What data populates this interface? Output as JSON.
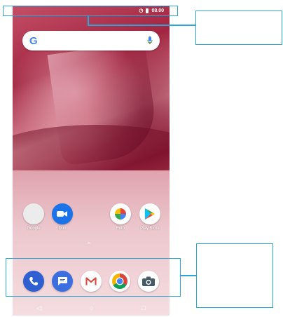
{
  "status_bar": {
    "time": "08.00"
  },
  "search": {
    "logo": "G"
  },
  "home_apps": [
    {
      "name": "google-folder",
      "label": "Google"
    },
    {
      "name": "duo",
      "label": "Duo"
    },
    {
      "name": "photos",
      "label": "Foto"
    },
    {
      "name": "play-store",
      "label": "Play Store"
    }
  ],
  "dock": [
    "phone",
    "messages",
    "gmail",
    "chrome",
    "camera"
  ],
  "colors": {
    "annotation": "#2aa6d8",
    "duo": "#1a73e8",
    "phone": "#2f5fd0",
    "messages": "#3b6fe0",
    "chrome_red": "#db4437",
    "chrome_yellow": "#f4b400",
    "chrome_green": "#0f9d58"
  }
}
